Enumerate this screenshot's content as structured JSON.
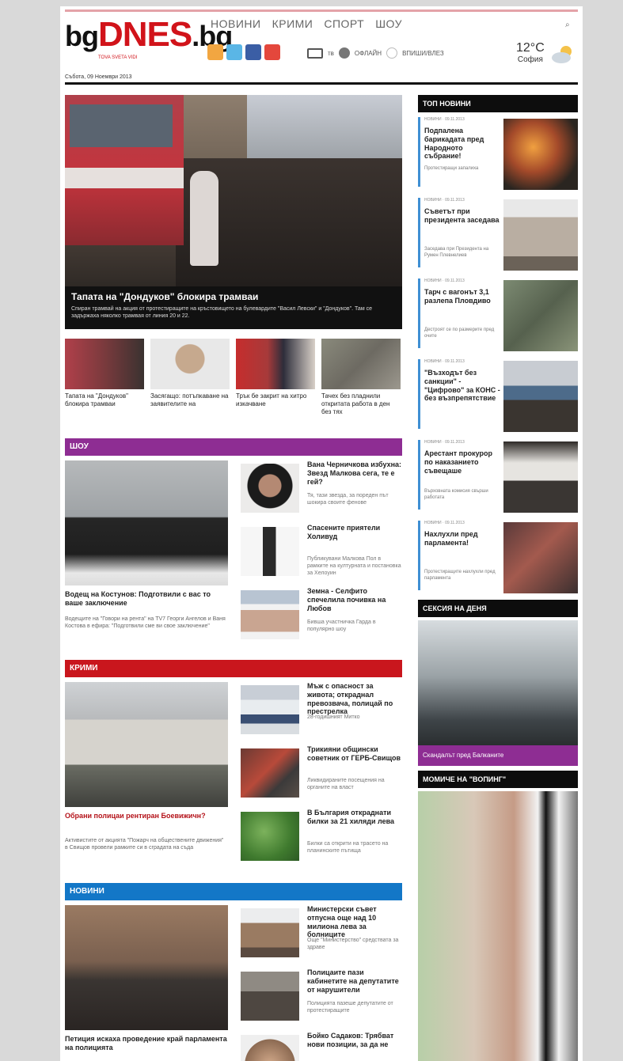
{
  "site": {
    "logo_a": "bg",
    "logo_b": "DNES",
    "logo_c": ".bg",
    "tagline": "TOVA SVETA VIDI",
    "date": "Събота, 09 Ноември 2013"
  },
  "nav": [
    "НОВИНИ",
    "КРИМИ",
    "СПОРТ",
    "ШОУ"
  ],
  "tools": {
    "tv": "тв",
    "radio": "ОФЛАЙН",
    "login": "ВПИШИ/ВЛЕЗ"
  },
  "weather": {
    "temp": "12°C",
    "city": "София"
  },
  "lead": {
    "title": "Тапата на \"Дондуков\" блокира трамваи",
    "desc": "Спиран трамвай на акция от протестиращите на кръстовището на булевардите \"Васил Левски\" и \"Дондуков\". Там се задържаха няколко трамвая от линия 20 и 22."
  },
  "thumbs": [
    {
      "text": "Тапата на \"Дондуков\" блокира трамваи"
    },
    {
      "text": "Засягащо: потъпкаване на заявителите на"
    },
    {
      "text": "Трък бе закрит на хитро изкачване"
    },
    {
      "text": "Тачех без пладнили откритата работа в ден без тях"
    }
  ],
  "sections": {
    "show": {
      "label": "ШОУ",
      "main_title": "Водещ на Костунов: Подготвили с вас то ваше заключение",
      "main_desc": "Водещите на \"Говори на рента\" на TV7 Георги Ангелов и Ваня Костова в ефира: \"Подготвили сме ви свое заключение\"",
      "items": [
        {
          "title": "Вана Черничкова избухна: Звезд Малкова сега, те е гей?",
          "desc": "Тя, тази звезда, за пореден път шокира своите фенове"
        },
        {
          "title": "Спасените приятели Холивуд",
          "desc": "Публикувани Малкова Пол в рамките на културната и постановка за Хелоуин"
        },
        {
          "title": "Земна - Селфито спечелила почивка на Любов",
          "desc": "Бивша участничка Гарда в популярно шоу"
        }
      ]
    },
    "crime": {
      "label": "КРИМИ",
      "main_title": "Обрани полицаи рентиран Боевижичн?",
      "main_desc": "Активистите от акцията \"Пожарч на обществените движения\" в Свищов провели рамките си в сградата на съда",
      "items": [
        {
          "title": "Мъж с опасност за живота; откраднал превозвача, полицай по престрелка",
          "desc": "28-годишният Митко"
        },
        {
          "title": "Трикияни общински советник от ГЕРБ-Свищов",
          "desc": "Ликвидираните посещения на органите на власт"
        },
        {
          "title": "В България откраднати билки за 21 хиляди лева",
          "desc": "Билки са открити на трасето на планинските пътища"
        }
      ]
    },
    "news": {
      "label": "НОВИНИ",
      "main_title": "Петиция искаха проведение край парламента на полицията",
      "items": [
        {
          "title": "Министерски съвет отпусна още над 10 милиона лева за болниците",
          "desc": "Още \"Министерство\" средствата за здраве"
        },
        {
          "title": "Полицаите пази кабинетите на депутатите от нарушители",
          "desc": "Полицията пазеше депутатите от протестиращите"
        },
        {
          "title": "Бойко Садаков: Трябват нови позиции, за да не",
          "desc": ""
        }
      ]
    }
  },
  "right": {
    "top_label": "ТОП НОВИНИ",
    "top_items": [
      {
        "meta": "НОВИНИ · 09.11.2013",
        "title": "Подпалена барикадата пред Народното събрание!",
        "desc": "Протестиращи запалиха"
      },
      {
        "meta": "НОВИНИ · 09.11.2013",
        "title": "Съветът при президента заседава",
        "desc": "Заседава при Президента на Румен Плевнелиев"
      },
      {
        "meta": "НОВИНИ · 09.11.2013",
        "title": "Тарч с вагонът 3,1 разлепа Пловдиво",
        "desc": "Дестроят се по размерите пред очите"
      },
      {
        "meta": "НОВИНИ · 09.11.2013",
        "title": "\"Възходът без санкции\" - \"Цифрово\" за КОНС - без възпрепятствие",
        "desc": ""
      },
      {
        "meta": "НОВИНИ · 09.11.2013",
        "title": "Арестант прокурор по наказанието съвещаше",
        "desc": "Върховната комисия свърши работата"
      },
      {
        "meta": "НОВИНИ · 09.11.2013",
        "title": "Нахлухли пред парламента!",
        "desc": "Протестиращите нахлухли пред парламента"
      }
    ],
    "sitting_label": "СЕКСИЯ НА ДЕНЯ",
    "sitting_caption": "Скандалът пред Балканите",
    "model_label": "МОМИЧЕ НА \"ВОПИНГ\""
  }
}
